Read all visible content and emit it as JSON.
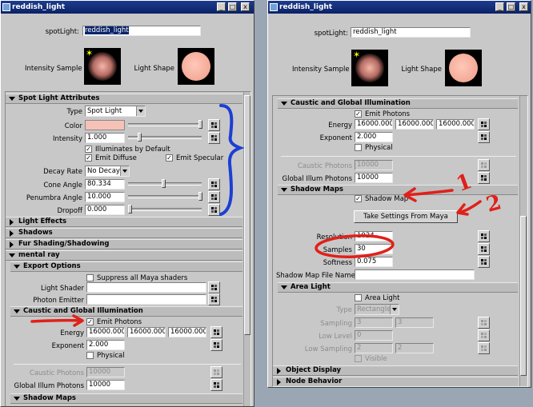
{
  "left_window": {
    "title": "reddish_light",
    "node_type_label": "spotLight:",
    "node_name": "reddish_light",
    "intensity_sample_label": "Intensity Sample",
    "light_shape_label": "Light Shape",
    "spot_section": "Spot Light Attributes",
    "type_label": "Type",
    "type_value": "Spot Light",
    "color_label": "Color",
    "color_value": "#f6c2b7",
    "intensity_label": "Intensity",
    "intensity_value": "1.000",
    "illuminates_label": "Illuminates by Default",
    "emit_diffuse_label": "Emit Diffuse",
    "emit_specular_label": "Emit Specular",
    "decay_label": "Decay Rate",
    "decay_value": "No Decay",
    "cone_label": "Cone Angle",
    "cone_value": "80.334",
    "penumbra_label": "Penumbra Angle",
    "penumbra_value": "10.000",
    "dropoff_label": "Dropoff",
    "dropoff_value": "0.000",
    "light_effects": "Light Effects",
    "shadows": "Shadows",
    "fur": "Fur Shading/Shadowing",
    "mental_ray": "mental ray",
    "export_options": "Export Options",
    "suppress_label": "Suppress all Maya shaders",
    "light_shader_label": "Light Shader",
    "photon_emitter_label": "Photon Emitter",
    "caustic_section": "Caustic and Global Illumination",
    "emit_photons_label": "Emit Photons",
    "energy_label": "Energy",
    "energy_r": "16000.000",
    "energy_g": "16000.000",
    "energy_b": "16000.000",
    "exponent_label": "Exponent",
    "exponent_value": "2.000",
    "physical_label": "Physical",
    "caustic_photons_label": "Caustic Photons",
    "caustic_photons_value": "10000",
    "gi_photons_label": "Global Illum Photons",
    "gi_photons_value": "10000",
    "shadow_maps_cut": "Shadow Maps"
  },
  "right_window": {
    "title": "reddish_light",
    "node_type_label": "spotLight:",
    "node_name": "reddish_light",
    "intensity_sample_label": "Intensity Sample",
    "light_shape_label": "Light Shape",
    "caustic_section": "Caustic and Global Illumination",
    "emit_photons_label": "Emit Photons",
    "energy_label": "Energy",
    "energy_r": "16000.000",
    "energy_g": "16000.000",
    "energy_b": "16000.000",
    "exponent_label": "Exponent",
    "exponent_value": "2.000",
    "physical_label": "Physical",
    "caustic_photons_label": "Caustic Photons",
    "caustic_photons_value": "10000",
    "gi_photons_label": "Global Illum Photons",
    "gi_photons_value": "10000",
    "shadow_maps_section": "Shadow Maps",
    "shadow_map_label": "Shadow Map",
    "take_settings_label": "Take Settings From Maya",
    "resolution_label": "Resolution",
    "resolution_value": "1024",
    "samples_label": "Samples",
    "samples_value": "30",
    "softness_label": "Softness",
    "softness_value": "0.075",
    "shadow_file_label": "Shadow Map File Name",
    "area_light_section": "Area Light",
    "area_light_label": "Area Light",
    "area_type_label": "Type",
    "area_type_value": "Rectangle",
    "sampling_label": "Sampling",
    "sampling_a": "3",
    "sampling_b": "3",
    "low_level_label": "Low Level",
    "low_level_value": "0",
    "low_sampling_label": "Low Sampling",
    "low_sampling_a": "2",
    "low_sampling_b": "2",
    "visible_label": "Visible",
    "object_display": "Object Display",
    "node_behavior": "Node Behavior"
  },
  "annotations": {
    "number_1": "1",
    "number_2": "2",
    "red": "#e0201a",
    "blue": "#1c3fd4"
  },
  "window_buttons": {
    "minimize": "_",
    "maximize": "□",
    "close": "x"
  }
}
